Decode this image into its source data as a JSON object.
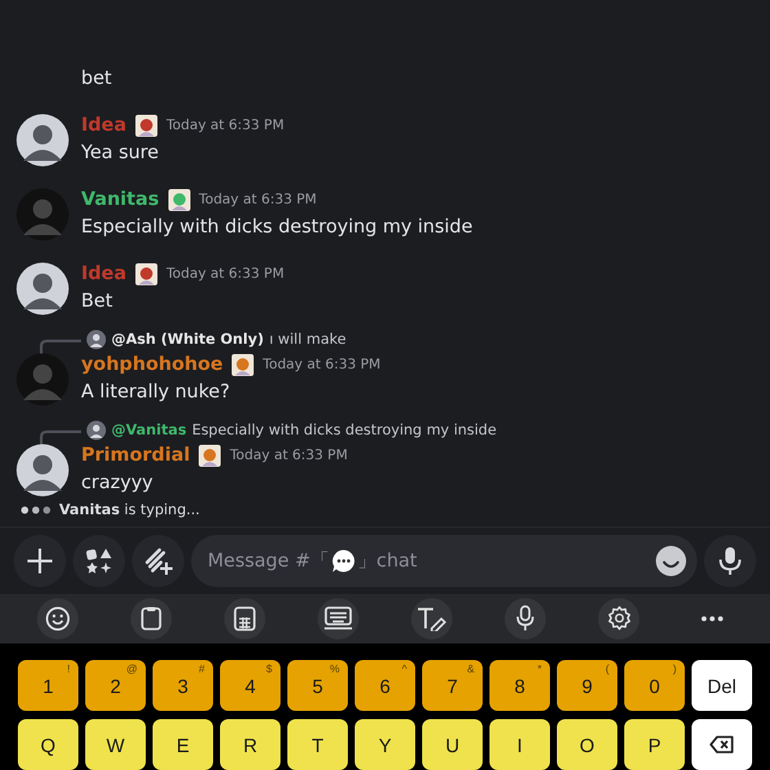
{
  "messages": [
    {
      "text": "bet"
    },
    {
      "author": "Idea",
      "color": "#c0392b",
      "time": "Today at 6:33 PM",
      "text": "Yea sure"
    },
    {
      "author": "Vanitas",
      "color": "#3fb86b",
      "time": "Today at 6:33 PM",
      "text": "Especially with dicks destroying my inside"
    },
    {
      "author": "Idea",
      "color": "#c0392b",
      "time": "Today at 6:33 PM",
      "text": "Bet"
    },
    {
      "reply": {
        "mention": "@Ash (White Only)",
        "color": "#e6e6e6",
        "text": "ı will make"
      },
      "author": "yohphohohoe",
      "color": "#d7761f",
      "time": "Today at 6:33 PM",
      "text": "A literally nuke?"
    },
    {
      "reply": {
        "mention": "@Vanitas",
        "color": "#3fb86b",
        "text": "Especially with dicks destroying my inside"
      },
      "author": "Primordial",
      "color": "#d7761f",
      "time": "Today at 6:33 PM",
      "text": "crazyyy"
    }
  ],
  "typing": "**Vanitas** is typing...",
  "composer": {
    "placeholder_start": "Message #「",
    "placeholder_end": "」chat"
  },
  "keyboard": {
    "rows": [
      [
        {
          "kind": "number",
          "label": "1",
          "hint": "!"
        },
        {
          "kind": "number",
          "label": "2",
          "hint": "@"
        },
        {
          "kind": "number",
          "label": "3",
          "hint": "#"
        },
        {
          "kind": "number",
          "label": "4",
          "hint": "$"
        },
        {
          "kind": "number",
          "label": "5",
          "hint": "%"
        },
        {
          "kind": "number",
          "label": "6",
          "hint": "^"
        },
        {
          "kind": "number",
          "label": "7",
          "hint": "&"
        },
        {
          "kind": "number",
          "label": "8",
          "hint": "*"
        },
        {
          "kind": "number",
          "label": "9",
          "hint": "("
        },
        {
          "kind": "number",
          "label": "0",
          "hint": ")"
        },
        {
          "kind": "function",
          "label": "Del"
        }
      ],
      [
        {
          "kind": "letter",
          "label": "Q"
        },
        {
          "kind": "letter",
          "label": "W"
        },
        {
          "kind": "letter",
          "label": "E"
        },
        {
          "kind": "letter",
          "label": "R"
        },
        {
          "kind": "letter",
          "label": "T"
        },
        {
          "kind": "letter",
          "label": "Y"
        },
        {
          "kind": "letter",
          "label": "U"
        },
        {
          "kind": "letter",
          "label": "I"
        },
        {
          "kind": "letter",
          "label": "O"
        },
        {
          "kind": "letter",
          "label": "P"
        },
        {
          "kind": "backspace"
        }
      ]
    ]
  }
}
